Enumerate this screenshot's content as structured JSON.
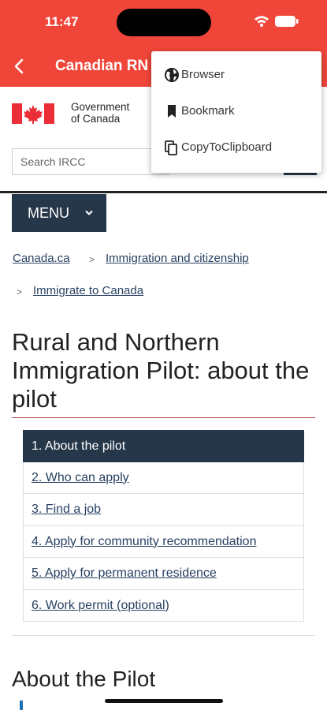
{
  "status_bar": {
    "time": "11:47"
  },
  "app_bar": {
    "title": "Canadian RN"
  },
  "header": {
    "gov_line1": "Government",
    "gov_line2": "of Canada",
    "search_placeholder": "Search IRCC"
  },
  "menu": {
    "label": "MENU"
  },
  "breadcrumbs": [
    {
      "label": "Canada.ca"
    },
    {
      "label": "Immigration and citizenship"
    },
    {
      "label": "Immigrate to Canada"
    }
  ],
  "breadcrumb_separator": ">",
  "page": {
    "title": "Rural and Northern Immigration Pilot: about the pilot",
    "section_title": "About the Pilot"
  },
  "toc": [
    {
      "label": "1. About the pilot",
      "active": true
    },
    {
      "label": "2. Who can apply",
      "active": false
    },
    {
      "label": "3. Find a job",
      "active": false
    },
    {
      "label": "4. Apply for community recommendation",
      "active": false
    },
    {
      "label": "5. Apply for permanent residence",
      "active": false
    },
    {
      "label": "6. Work permit (optional)",
      "active": false
    }
  ],
  "popup_menu": [
    {
      "label": "Browser",
      "icon": "globe-icon"
    },
    {
      "label": "Bookmark",
      "icon": "bookmark-icon"
    },
    {
      "label": "CopyToClipboard",
      "icon": "copy-icon"
    }
  ],
  "colors": {
    "app_bar": "#f0463a",
    "navy": "#26374a",
    "link": "#284162",
    "flag_red": "#eb2d37"
  }
}
